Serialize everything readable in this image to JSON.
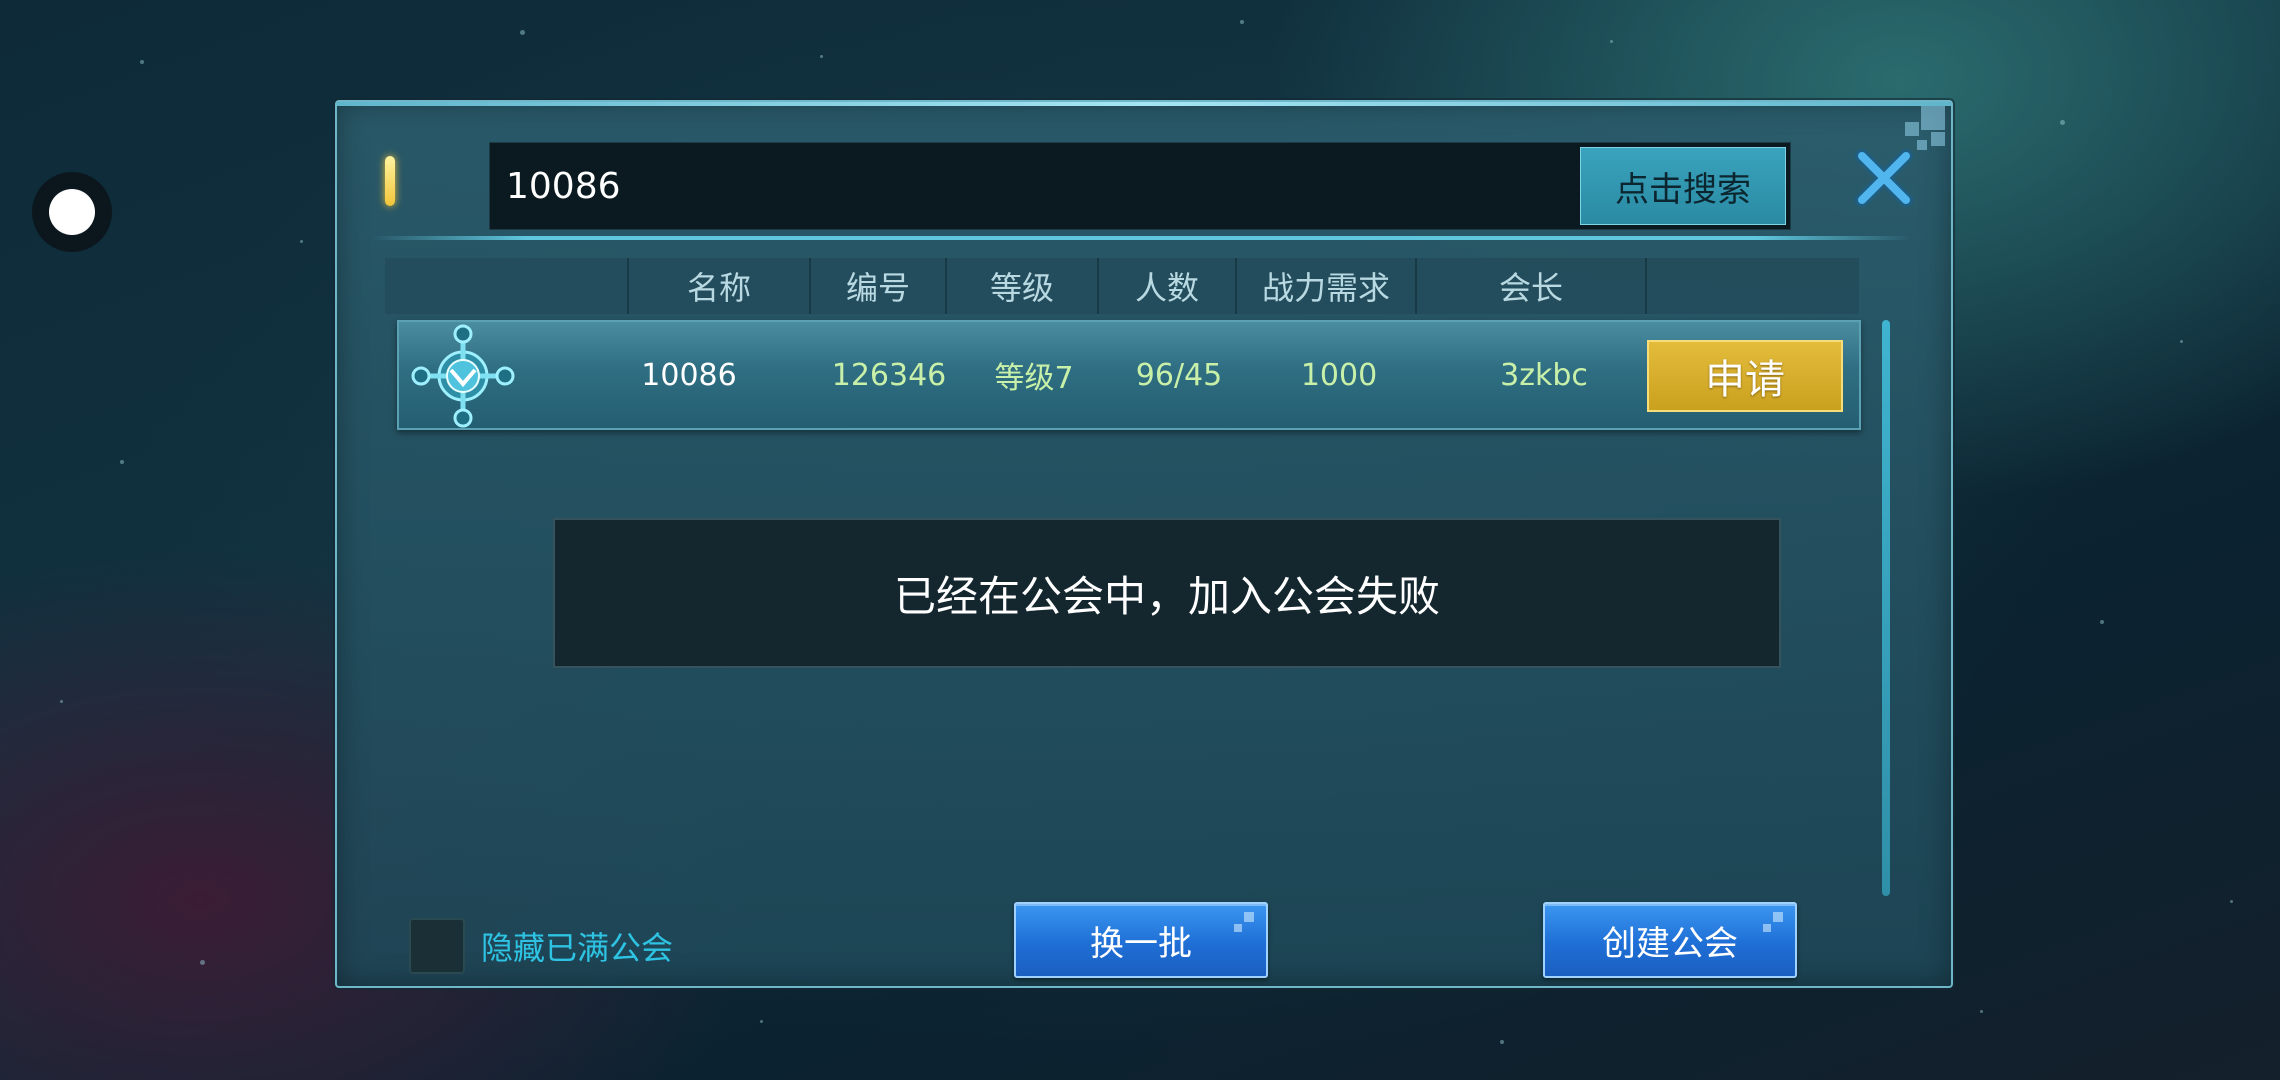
{
  "search": {
    "value": "10086",
    "button_label": "点击搜索"
  },
  "table": {
    "headers": [
      "名称",
      "编号",
      "等级",
      "人数",
      "战力需求",
      "会长"
    ],
    "rows": [
      {
        "name": "10086",
        "id": "126346",
        "level": "等级7",
        "members": "96/45",
        "power_req": "1000",
        "leader": "3zkbc",
        "action": "申请"
      }
    ]
  },
  "toast": {
    "message": "已经在公会中，加入公会失败"
  },
  "footer": {
    "hide_full_label": "隐藏已满公会",
    "hide_full_checked": false,
    "refresh_label": "换一批",
    "create_label": "创建公会"
  },
  "icons": {
    "close": "close-icon",
    "emblem": "guild-emblem-icon",
    "float_ball": "floating-assistant-icon"
  },
  "colors": {
    "apply_button": "#d4ad2a",
    "blue_button": "#1f6fd6",
    "accent_text": "#2ec3e3",
    "value_green": "#c8f0a8"
  }
}
